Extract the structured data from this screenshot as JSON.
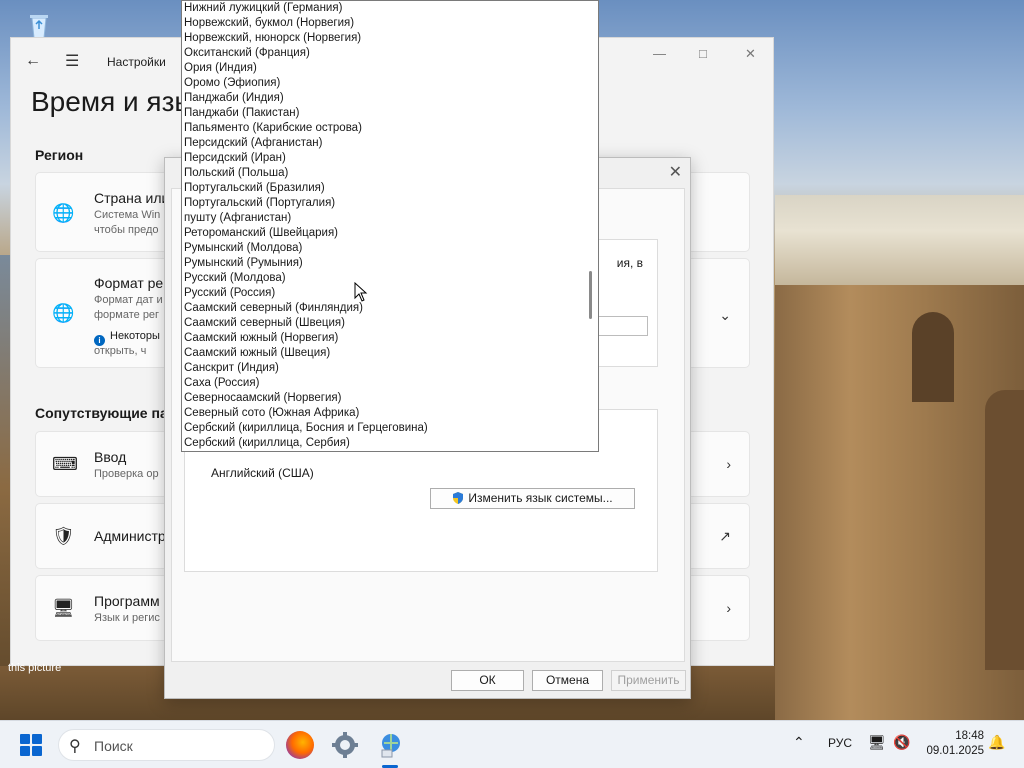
{
  "settings": {
    "app_title": "Настройки",
    "page_title": "Время и язы",
    "region_header": "Регион",
    "country_card": {
      "title": "Страна или",
      "sub1": "Система Win",
      "sub2": "чтобы предо"
    },
    "format_card": {
      "title": "Формат ре",
      "sub1": "Формат дат и",
      "sub2": "формате рег",
      "note1": "Некоторы",
      "note2": "открыть, ч"
    },
    "related_header": "Сопутствующие пар",
    "input_card": {
      "title": "Ввод",
      "sub": "Проверка ор"
    },
    "admin_card": {
      "title": "Администр"
    },
    "program_card": {
      "title": "Программ",
      "sub": "Язык и регис"
    }
  },
  "wallpaper_caption": "this picture",
  "dialog": {
    "partial_text": "ия, в",
    "system_language": "Английский (США)",
    "change_system_language_button": "Изменить язык системы...",
    "ok_button": "ОК",
    "cancel_button": "Отмена",
    "apply_button": "Применить"
  },
  "dropdown": {
    "items": [
      "Нижний лужицкий (Германия)",
      "Норвежский, букмол (Норвегия)",
      "Норвежский, нюнорск (Норвегия)",
      "Окситанский (Франция)",
      "Ория (Индия)",
      "Оромо (Эфиопия)",
      "Панджаби (Индия)",
      "Панджаби (Пакистан)",
      "Папьяменто (Карибские острова)",
      "Персидский (Афганистан)",
      "Персидский (Иран)",
      "Польский (Польша)",
      "Португальский (Бразилия)",
      "Португальский (Португалия)",
      "пушту (Афганистан)",
      "Ретороманский (Швейцария)",
      "Румынский (Молдова)",
      "Румынский (Румыния)",
      "Русский (Молдова)",
      "Русский (Россия)",
      "Саамский северный (Финляндия)",
      "Саамский северный (Швеция)",
      "Саамский южный (Норвегия)",
      "Саамский южный (Швеция)",
      "Санскрит (Индия)",
      "Саха (Россия)",
      "Северносаамский (Норвегия)",
      "Северный сото (Южная Африка)",
      "Сербский (кириллица, Босния и Герцеговина)",
      "Сербский (кириллица, Сербия)"
    ]
  },
  "taskbar": {
    "search_label": "Поиск",
    "language": "РУС",
    "time": "18:48",
    "date": "09.01.2025"
  },
  "icons": {
    "recycle_bin": "recycle-bin-icon",
    "firefox": "firefox-icon",
    "settings": "settings-gear-icon",
    "control_panel": "control-panel-icon"
  },
  "colors": {
    "accent": "#0a66d0",
    "dialog_bg": "#f0f0f0",
    "settings_bg": "#f3f3f3"
  }
}
